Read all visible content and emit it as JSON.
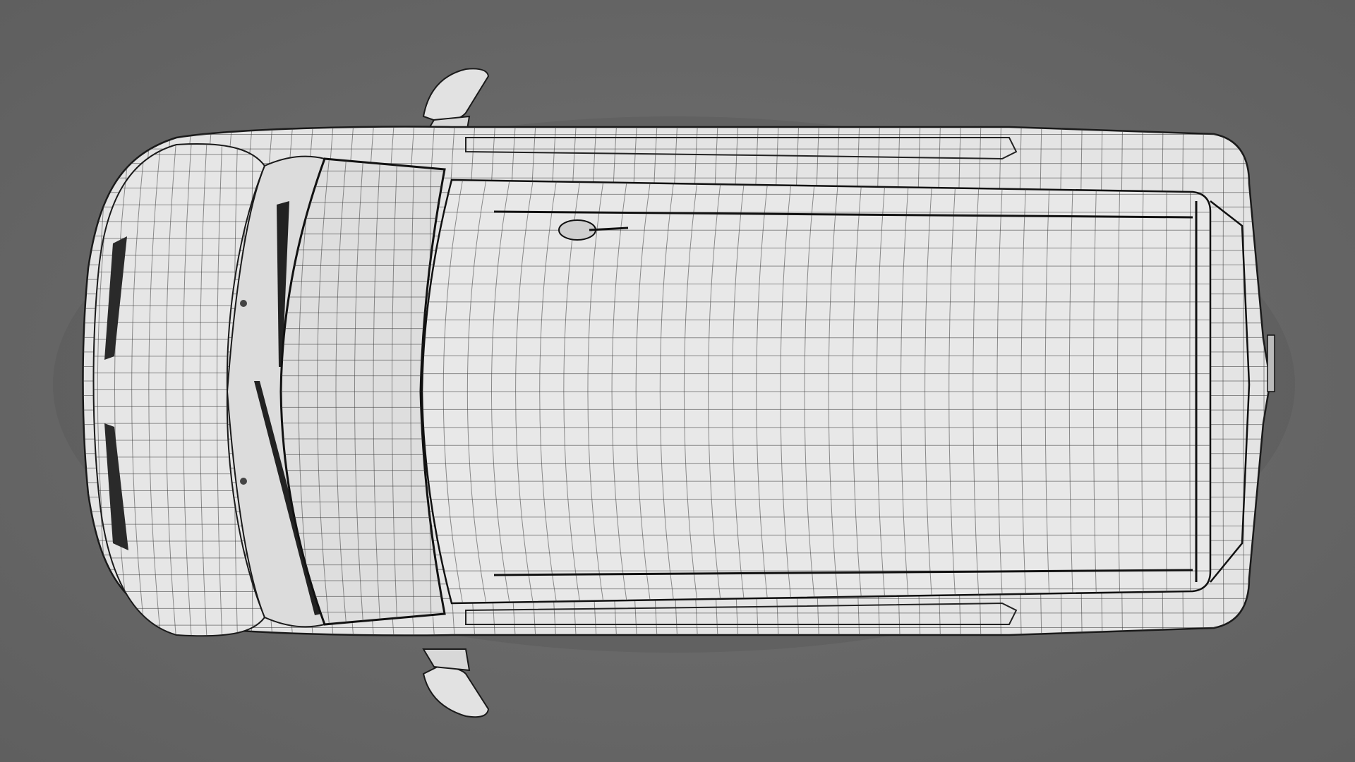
{
  "scene": {
    "subject": "van-top-view-wireframe",
    "colors": {
      "background": "#6b6b6b",
      "body": "#e4e4e4",
      "roof": "#e8e8e8",
      "glass": "#dedede",
      "wire": "#3a3a3a",
      "outline": "#1a1a1a"
    },
    "grid": {
      "roof_columns": 34,
      "roof_rows": 24,
      "hood_columns": 12,
      "hood_rows": 30,
      "windshield_columns": 10,
      "windshield_rows": 30
    }
  }
}
